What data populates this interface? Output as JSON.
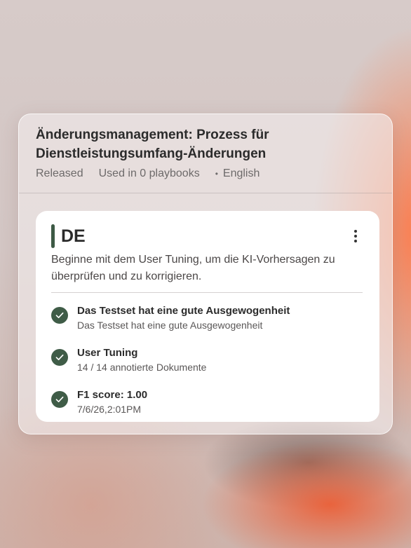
{
  "panel": {
    "title": "Änderungsmanagement: Prozess für Dienstleistungsumfang-Änderungen",
    "status": "Released",
    "usage": "Used in 0 playbooks",
    "language": "English"
  },
  "card": {
    "label": "DE",
    "description": "Beginne mit dem User Tuning, um die KI-Vorhersagen zu überprüfen und zu korrigieren.",
    "checks": [
      {
        "title": "Das Testset hat eine gute Ausgewogenheit",
        "subtitle": "Das Testset hat eine gute Ausgewogenheit"
      },
      {
        "title": "User Tuning",
        "subtitle": "14 / 14 annotierte Dokumente"
      },
      {
        "title": "F1 score: 1.00",
        "subtitle": "7/6/26,2:01PM"
      }
    ]
  },
  "icons": {
    "check": "check-circle-icon",
    "menu": "more-vertical-icon"
  },
  "colors": {
    "accent": "#3f5c47",
    "card": "#ffffff"
  }
}
